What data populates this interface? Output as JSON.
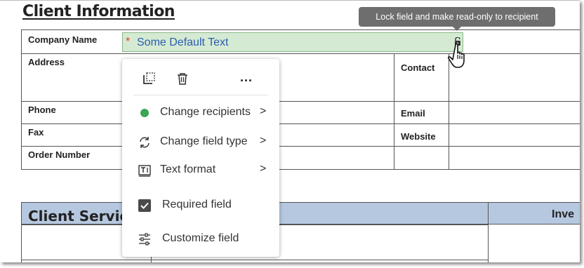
{
  "document": {
    "heading": "Client Information",
    "info_labels": {
      "company_name": "Company Name",
      "address": "Address",
      "phone": "Phone",
      "fax": "Fax",
      "order_number": "Order Number",
      "contact": "Contact",
      "email": "Email",
      "website": "Website"
    },
    "service_title": "Client Servic",
    "inventory_title": "Inve"
  },
  "field": {
    "required_marker": "*",
    "value": "Some Default Text"
  },
  "tooltip": {
    "text": "Lock field and make read-only to recipient"
  },
  "context_menu": {
    "toolbar": {
      "icons": [
        "duplicate-icon",
        "trash-icon",
        "more-icon"
      ],
      "more_label": "..."
    },
    "items": [
      {
        "label": "Change recipients",
        "icon": "recipient-dot-icon",
        "has_submenu": true
      },
      {
        "label": "Change field type",
        "icon": "refresh-icon",
        "has_submenu": true
      },
      {
        "label": "Text format",
        "icon": "text-format-icon",
        "has_submenu": true
      },
      {
        "label": "Required field",
        "icon": "checkbox-checked-icon",
        "has_submenu": false
      },
      {
        "label": "Customize field",
        "icon": "sliders-icon",
        "has_submenu": false
      }
    ],
    "chevron": ">"
  },
  "colors": {
    "field_bg": "#d5ead2",
    "field_text": "#2a5db0",
    "required_star": "#d9442b",
    "recipient_dot": "#3aa655",
    "table_header": "#b6c8e0",
    "tooltip_bg": "#6e6e6e"
  }
}
